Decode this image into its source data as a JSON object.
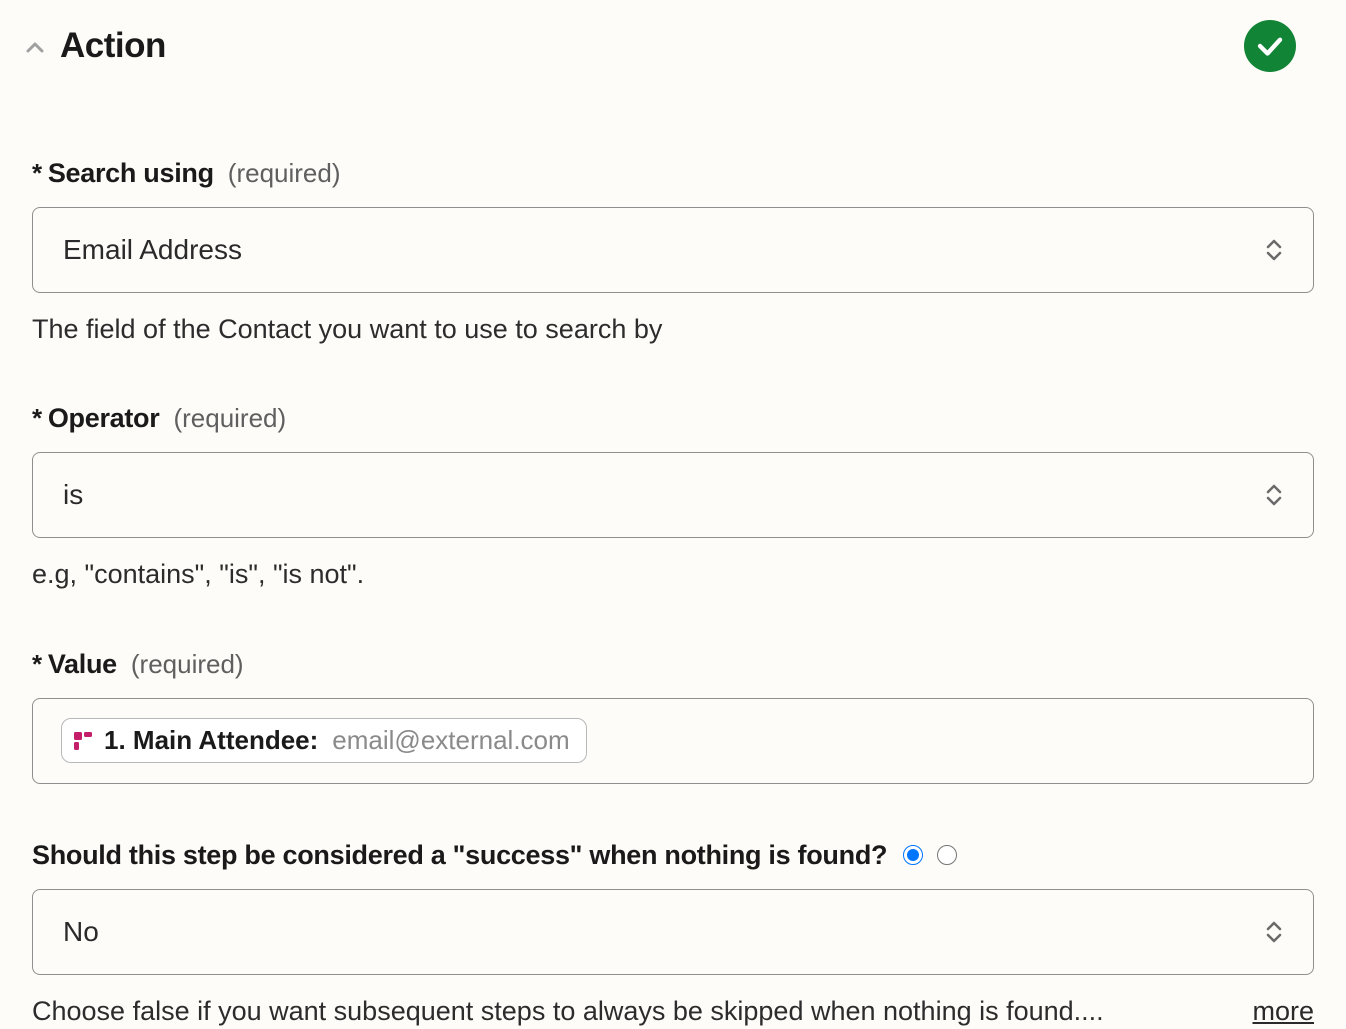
{
  "header": {
    "title": "Action",
    "status": "success"
  },
  "fields": {
    "search_using": {
      "asterisk": "*",
      "label": "Search using",
      "required_tag": "(required)",
      "value": "Email Address",
      "help": "The field of the Contact you want to use to search by"
    },
    "operator": {
      "asterisk": "*",
      "label": "Operator",
      "required_tag": "(required)",
      "value": "is",
      "help": "e.g, \"contains\", \"is\", \"is not\"."
    },
    "value": {
      "asterisk": "*",
      "label": "Value",
      "required_tag": "(required)",
      "pill_label": "1. Main Attendee:",
      "pill_value": "email@external.com"
    },
    "success_step": {
      "label": "Should this step be considered a \"success\" when nothing is found?",
      "value": "No",
      "help": "Choose false if you want subsequent steps to always be skipped when nothing is found....",
      "more": "more"
    }
  }
}
